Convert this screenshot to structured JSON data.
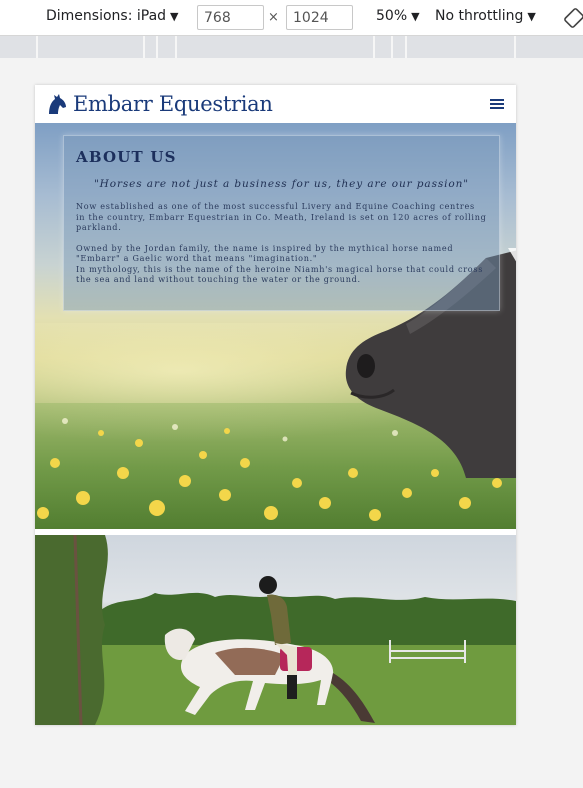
{
  "devtools": {
    "dimensions_label": "Dimensions: iPad",
    "width_value": "768",
    "height_value": "1024",
    "times": "×",
    "zoom": "50%",
    "throttling": "No throttling",
    "caret": "▼"
  },
  "site": {
    "brand_name": "Embarr Equestrian",
    "brand_color": "#1a3a7a"
  },
  "about": {
    "title": "ABOUT US",
    "quote": "\"Horses are not just a business for us, they are our passion\"",
    "paragraph_1": "Now established as one of the most successful Livery and Equine Coaching centres in the country, Embarr Equestrian in Co. Meath, Ireland is set on 120 acres of rolling parkland.",
    "paragraph_2a": "Owned by the Jordan family, the name is inspired by the mythical horse named \"Embarr\" a Gaelic word that means \"imagination.\"",
    "paragraph_2b": "In mythology, this is the name of the heroine Niamh's magical horse that could cross the sea and land without touching the water or the ground."
  }
}
